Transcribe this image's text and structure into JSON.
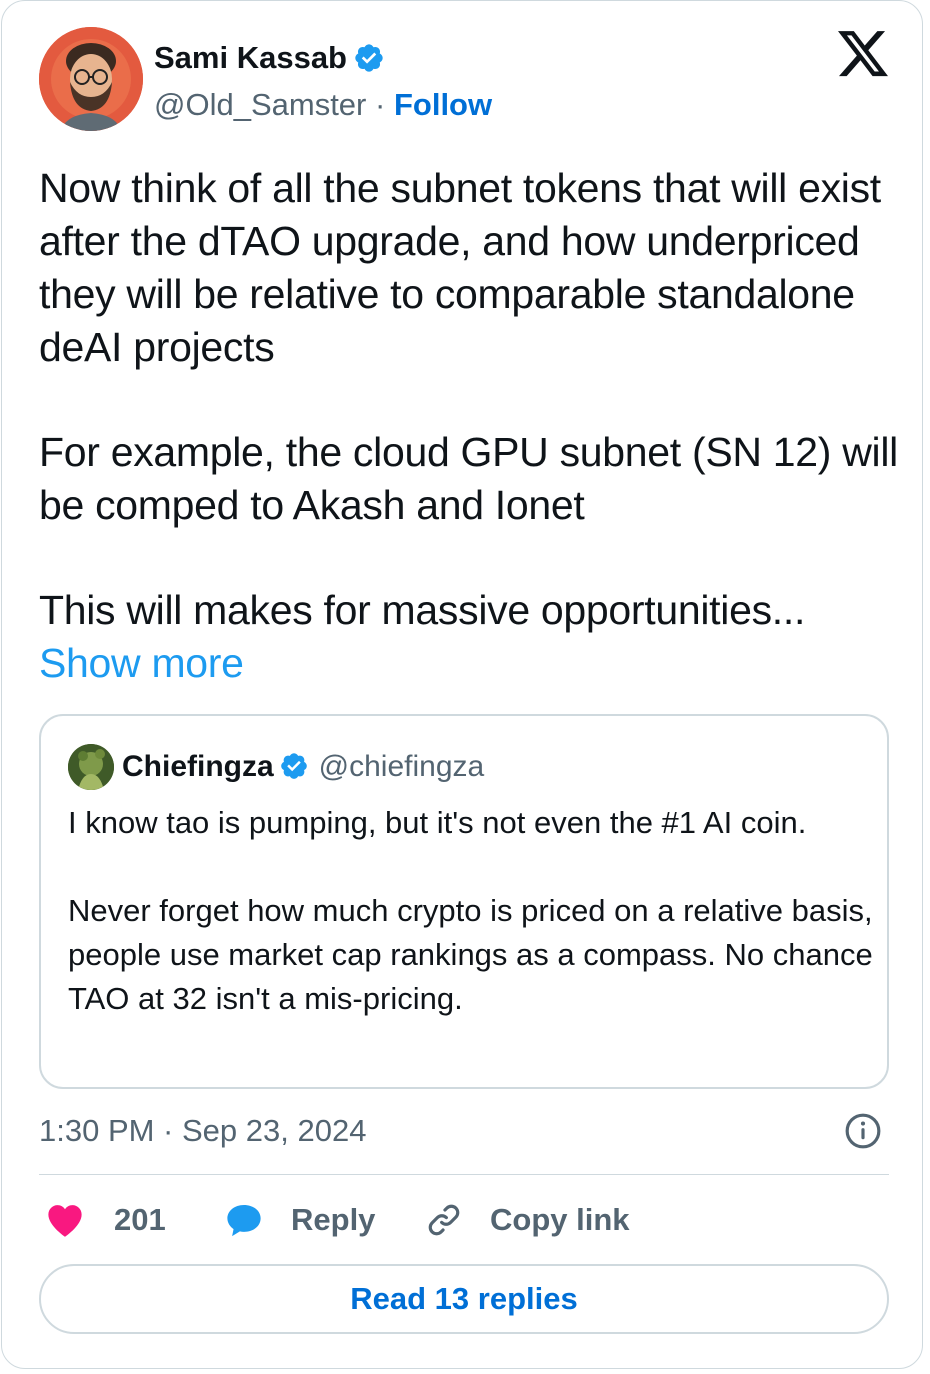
{
  "author": {
    "name": "Sami Kassab",
    "handle": "@Old_Samster",
    "separator": "·",
    "follow_label": "Follow",
    "verified": true
  },
  "tweet": {
    "paragraphs": [
      "Now think of all the subnet tokens that will exist after the dTAO upgrade, and how underpriced they will be relative to comparable standalone deAI projects",
      "For example, the cloud GPU subnet (SN 12) will be comped to Akash and Ionet",
      "This will makes for massive opportunities..."
    ],
    "show_more_label": "Show more"
  },
  "quote": {
    "name": "Chiefingza",
    "handle": "@chiefingza",
    "verified": true,
    "paragraphs": [
      "I know tao is pumping, but it's not even the #1 AI coin.",
      "Never forget how much crypto is priced on a relative basis, people use market cap rankings as a compass. No chance TAO at 32 isn't a mis-pricing."
    ]
  },
  "meta": {
    "timestamp": "1:30 PM · Sep 23, 2024"
  },
  "actions": {
    "likes_count": "201",
    "reply_label": "Reply",
    "copy_link_label": "Copy link"
  },
  "read_replies_label": "Read 13 replies",
  "colors": {
    "like": "#f91880",
    "reply": "#1d9bf0",
    "link": "#006fd6",
    "verified": "#1d9bf0",
    "secondary_text": "#536471",
    "border": "#cfd9de"
  },
  "icons": [
    "verified-badge-icon",
    "x-logo-icon",
    "info-icon",
    "heart-icon",
    "reply-bubble-icon",
    "link-icon"
  ]
}
